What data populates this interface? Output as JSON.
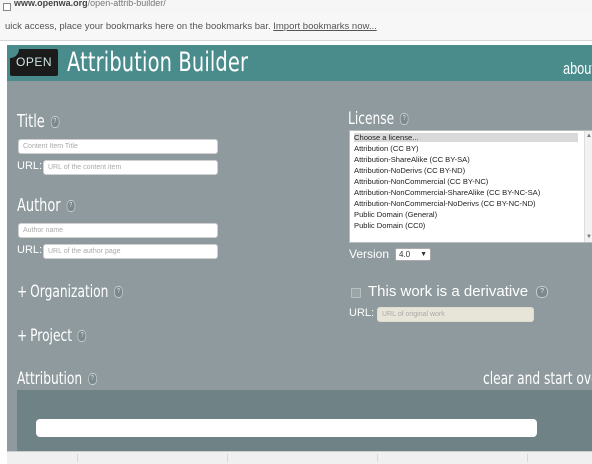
{
  "browser": {
    "url_host": "www.openwa.org",
    "url_path": "/open-attrib-builder/",
    "bookmarks_message": "uick access, place your bookmarks here on the bookmarks bar.",
    "import_link": "Import bookmarks now..."
  },
  "header": {
    "logo_text": "OPEN",
    "title": "Attribution Builder",
    "about_link": "about"
  },
  "form": {
    "title": {
      "label": "Title",
      "placeholder": "Content Item Title",
      "url_label": "URL:",
      "url_placeholder": "URL of the content item"
    },
    "author": {
      "label": "Author",
      "placeholder": "Author name",
      "url_label": "URL:",
      "url_placeholder": "URL of the author page"
    },
    "organization": {
      "label": "Organization",
      "prefix": "+"
    },
    "project": {
      "label": "Project",
      "prefix": "+"
    },
    "attribution": {
      "label": "Attribution",
      "clear_link": "clear and start over"
    },
    "help_glyph": "?"
  },
  "license": {
    "label": "License",
    "options": [
      "Choose a license...",
      "Attribution (CC BY)",
      "Attribution-ShareAlike (CC BY-SA)",
      "Attribution-NoDerivs (CC BY-ND)",
      "Attribution-NonCommercial (CC BY-NC)",
      "Attribution-NonCommercial-ShareAlike (CC BY-NC-SA)",
      "Attribution-NonCommercial-NoDerivs (CC BY-NC-ND)",
      "Public Domain (General)",
      "Public Domain (CC0)"
    ],
    "selected_index": 0,
    "version_label": "Version",
    "version_value": "4.0"
  },
  "derivative": {
    "label": "This work is a derivative",
    "checked": false,
    "url_label": "URL:",
    "url_placeholder": "URL of original work"
  },
  "colors": {
    "header_bg": "#4a8c8c",
    "panel_bg": "#8e9a9d",
    "attribution_bg": "#6f8285"
  }
}
